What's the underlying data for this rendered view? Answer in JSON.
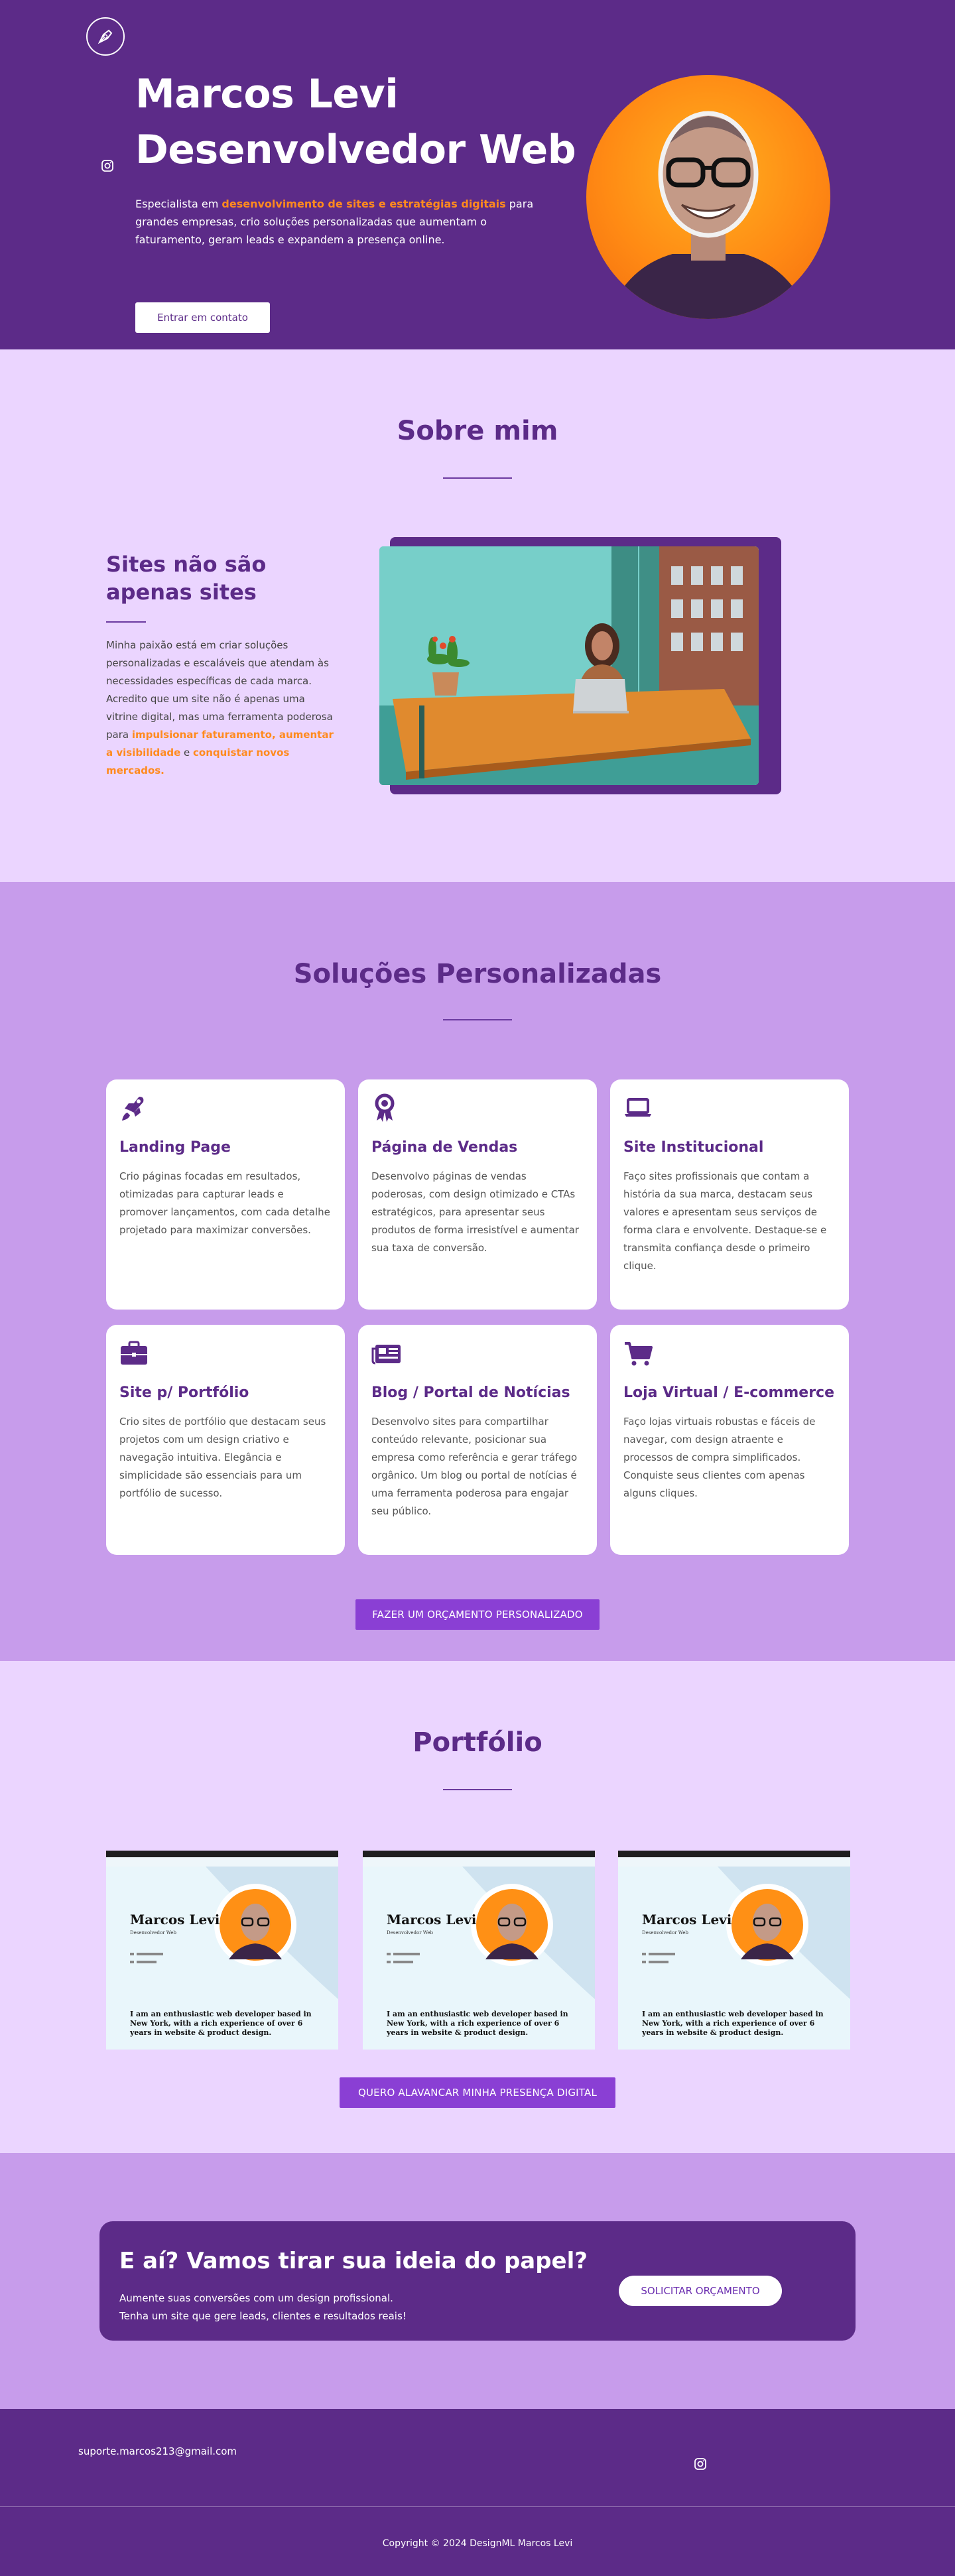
{
  "hero": {
    "title_line1": "Marcos Levi",
    "title_line2": "Desenvolvedor Web",
    "desc_prefix": "Especialista em ",
    "desc_highlight": "desenvolvimento de sites e estratégias digitais",
    "desc_suffix": " para grandes empresas, crio soluções personalizadas que aumentam o faturamento, geram leads e expandem a presença online.",
    "button_label": "Entrar em contato",
    "logo_icon": "pen-nib-icon",
    "social_icon": "instagram-icon"
  },
  "sobre": {
    "title": "Sobre mim",
    "heading": "Sites não são apenas sites",
    "p_part1": "Minha paixão está em criar soluções personalizadas e escaláveis que atendam às necessidades específicas de cada marca. Acredito que um site não é apenas uma vitrine digital, mas uma ferramenta poderosa para ",
    "p_hl1": "impulsionar faturamento, aumentar a visibilidade",
    "p_part2": " e ",
    "p_hl2": "conquistar novos mercados."
  },
  "solucoes": {
    "title": "Soluções Personalizadas",
    "cards": [
      {
        "icon": "rocket-icon",
        "title": "Landing Page",
        "text": "Crio páginas focadas em resultados, otimizadas para capturar leads e promover lançamentos, com cada detalhe projetado para maximizar conversões."
      },
      {
        "icon": "award-icon",
        "title": "Página de Vendas",
        "text": "Desenvolvo páginas de vendas poderosas, com design otimizado e CTAs estratégicos, para apresentar seus produtos de forma irresistível e aumentar sua taxa de conversão."
      },
      {
        "icon": "laptop-icon",
        "title": "Site Institucional",
        "text": "Faço sites profissionais que contam a história da sua marca, destacam seus valores e apresentam seus serviços de forma clara e envolvente. Destaque-se e transmita confiança desde o primeiro clique."
      },
      {
        "icon": "briefcase-icon",
        "title": "Site p/ Portfólio",
        "text": "Crio sites de portfólio que destacam seus projetos com um design criativo e navegação intuitiva. Elegância e simplicidade são essenciais para um portfólio de sucesso."
      },
      {
        "icon": "newspaper-icon",
        "title": "Blog / Portal de Notícias",
        "text": "Desenvolvo sites para compartilhar conteúdo relevante, posicionar sua empresa como referência e gerar tráfego orgânico. Um blog ou portal de notícias é uma ferramenta poderosa para engajar seu público."
      },
      {
        "icon": "cart-icon",
        "title": "Loja Virtual / E-commerce",
        "text": "Faço lojas virtuais robustas e fáceis de navegar, com design atraente e processos de compra simplificados. Conquiste seus clientes com apenas alguns cliques."
      }
    ],
    "button_label": "FAZER UM ORÇAMENTO PERSONALIZADO"
  },
  "portfolio": {
    "title": "Portfólio",
    "items": [
      {
        "name": "Marcos Levi",
        "role": "Desenvolvedor Web",
        "tagline": "I am an enthusiastic web developer based in New York, with a rich experience of over 6 years in website & product design."
      },
      {
        "name": "Marcos Levi",
        "role": "Desenvolvedor Web",
        "tagline": "I am an enthusiastic web developer based in New York, with a rich experience of over 6 years in website & product design."
      },
      {
        "name": "Marcos Levi",
        "role": "Desenvolvedor Web",
        "tagline": "I am an enthusiastic web developer based in New York, with a rich experience of over 6 years in website & product design."
      }
    ],
    "button_label": "QUERO ALAVANCAR MINHA PRESENÇA DIGITAL"
  },
  "banner": {
    "heading": "E aí? Vamos tirar sua ideia do papel?",
    "line1": "Aumente suas conversões com um design profissional.",
    "line2": "Tenha um site que gere leads, clientes e resultados reais!",
    "button_label": "SOLICITAR ORÇAMENTO"
  },
  "footer": {
    "email": "suporte.marcos213@gmail.com",
    "copyright": "Copyright © 2024 DesignML Marcos Levi",
    "social_icon": "instagram-icon"
  },
  "colors": {
    "primary": "#5c2b88",
    "accent": "#ff8a1e",
    "light_bg": "#ebd5ff",
    "mid_bg": "#c79ceb",
    "button": "#8a3fd4"
  }
}
